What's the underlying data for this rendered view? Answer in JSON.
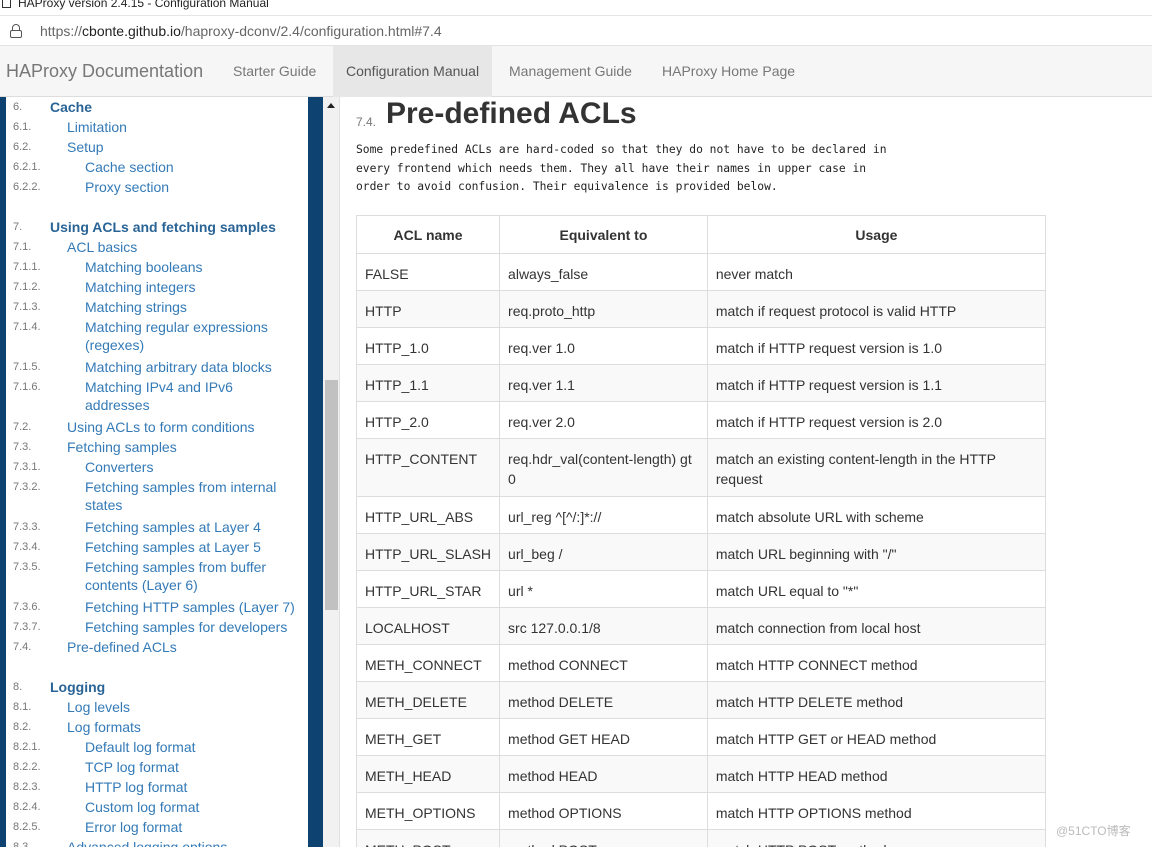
{
  "window": {
    "title": "HAProxy version 2.4.15 - Configuration Manual"
  },
  "address_bar": {
    "url_prefix": "https://",
    "url_host": "cbonte.github.io",
    "url_path": "/haproxy-dconv/2.4/configuration.html#7.4"
  },
  "navbar": {
    "brand": "HAProxy Documentation",
    "links": [
      "Starter Guide",
      "Configuration Manual",
      "Management Guide",
      "HAProxy Home Page"
    ],
    "active": "Configuration Manual"
  },
  "sidebar": {
    "items": [
      {
        "num": "6.",
        "label": "Cache",
        "level": 0
      },
      {
        "num": "6.1.",
        "label": "Limitation",
        "level": 1
      },
      {
        "num": "6.2.",
        "label": "Setup",
        "level": 1
      },
      {
        "num": "6.2.1.",
        "label": "Cache section",
        "level": 2
      },
      {
        "num": "6.2.2.",
        "label": "Proxy section",
        "level": 2
      },
      {
        "num": "7.",
        "label": "Using ACLs and fetching samples",
        "level": 0
      },
      {
        "num": "7.1.",
        "label": "ACL basics",
        "level": 1
      },
      {
        "num": "7.1.1.",
        "label": "Matching booleans",
        "level": 2
      },
      {
        "num": "7.1.2.",
        "label": "Matching integers",
        "level": 2
      },
      {
        "num": "7.1.3.",
        "label": "Matching strings",
        "level": 2
      },
      {
        "num": "7.1.4.",
        "label": "Matching regular expressions",
        "cont": "(regexes)",
        "level": 2
      },
      {
        "num": "7.1.5.",
        "label": "Matching arbitrary data blocks",
        "level": 2
      },
      {
        "num": "7.1.6.",
        "label": "Matching IPv4 and IPv6",
        "cont": "addresses",
        "level": 2
      },
      {
        "num": "7.2.",
        "label": "Using ACLs to form conditions",
        "level": 1
      },
      {
        "num": "7.3.",
        "label": "Fetching samples",
        "level": 1
      },
      {
        "num": "7.3.1.",
        "label": "Converters",
        "level": 2
      },
      {
        "num": "7.3.2.",
        "label": "Fetching samples from internal",
        "cont": "states",
        "level": 2
      },
      {
        "num": "7.3.3.",
        "label": "Fetching samples at Layer 4",
        "level": 2
      },
      {
        "num": "7.3.4.",
        "label": "Fetching samples at Layer 5",
        "level": 2
      },
      {
        "num": "7.3.5.",
        "label": "Fetching samples from buffer",
        "cont": "contents (Layer 6)",
        "level": 2
      },
      {
        "num": "7.3.6.",
        "label": "Fetching HTTP samples (Layer 7)",
        "level": 2
      },
      {
        "num": "7.3.7.",
        "label": "Fetching samples for developers",
        "level": 2
      },
      {
        "num": "7.4.",
        "label": "Pre-defined ACLs",
        "level": 1
      },
      {
        "num": "8.",
        "label": "Logging",
        "level": 0
      },
      {
        "num": "8.1.",
        "label": "Log levels",
        "level": 1
      },
      {
        "num": "8.2.",
        "label": "Log formats",
        "level": 1
      },
      {
        "num": "8.2.1.",
        "label": "Default log format",
        "level": 2
      },
      {
        "num": "8.2.2.",
        "label": "TCP log format",
        "level": 2
      },
      {
        "num": "8.2.3.",
        "label": "HTTP log format",
        "level": 2
      },
      {
        "num": "8.2.4.",
        "label": "Custom log format",
        "level": 2
      },
      {
        "num": "8.2.5.",
        "label": "Error log format",
        "level": 2
      },
      {
        "num": "8.3.",
        "label": "Advanced logging options",
        "level": 1
      }
    ]
  },
  "content": {
    "section_num": "7.4.",
    "section_title": "Pre-defined ACLs",
    "intro": "Some predefined ACLs are hard-coded so that they do not have to be declared in\nevery frontend which needs them. They all have their names in upper case in\norder to avoid confusion. Their equivalence is provided below.",
    "table": {
      "headers": [
        "ACL name",
        "Equivalent to",
        "Usage"
      ],
      "rows": [
        [
          "FALSE",
          "always_false",
          "never match"
        ],
        [
          "HTTP",
          "req.proto_http",
          "match if request protocol is valid HTTP"
        ],
        [
          "HTTP_1.0",
          "req.ver 1.0",
          "match if HTTP request version is 1.0"
        ],
        [
          "HTTP_1.1",
          "req.ver 1.1",
          "match if HTTP request version is 1.1"
        ],
        [
          "HTTP_2.0",
          "req.ver 2.0",
          "match if HTTP request version is 2.0"
        ],
        [
          "HTTP_CONTENT",
          "req.hdr_val(content-length) gt 0",
          "match an existing content-length in the HTTP request"
        ],
        [
          "HTTP_URL_ABS",
          "url_reg ^[^/:]*://",
          "match absolute URL with scheme"
        ],
        [
          "HTTP_URL_SLASH",
          "url_beg /",
          "match URL beginning with \"/\""
        ],
        [
          "HTTP_URL_STAR",
          "url *",
          "match URL equal to \"*\""
        ],
        [
          "LOCALHOST",
          "src 127.0.0.1/8",
          "match connection from local host"
        ],
        [
          "METH_CONNECT",
          "method CONNECT",
          "match HTTP CONNECT method"
        ],
        [
          "METH_DELETE",
          "method DELETE",
          "match HTTP DELETE method"
        ],
        [
          "METH_GET",
          "method GET HEAD",
          "match HTTP GET or HEAD method"
        ],
        [
          "METH_HEAD",
          "method HEAD",
          "match HTTP HEAD method"
        ],
        [
          "METH_OPTIONS",
          "method OPTIONS",
          "match HTTP OPTIONS method"
        ],
        [
          "METH_POST",
          "method POST",
          "match HTTP POST method"
        ]
      ]
    }
  },
  "watermark": "@51CTO博客",
  "colors": {
    "sidebar_band": "#0e4270",
    "link": "#337ab7",
    "navbar_bg": "#f6f6f6"
  }
}
